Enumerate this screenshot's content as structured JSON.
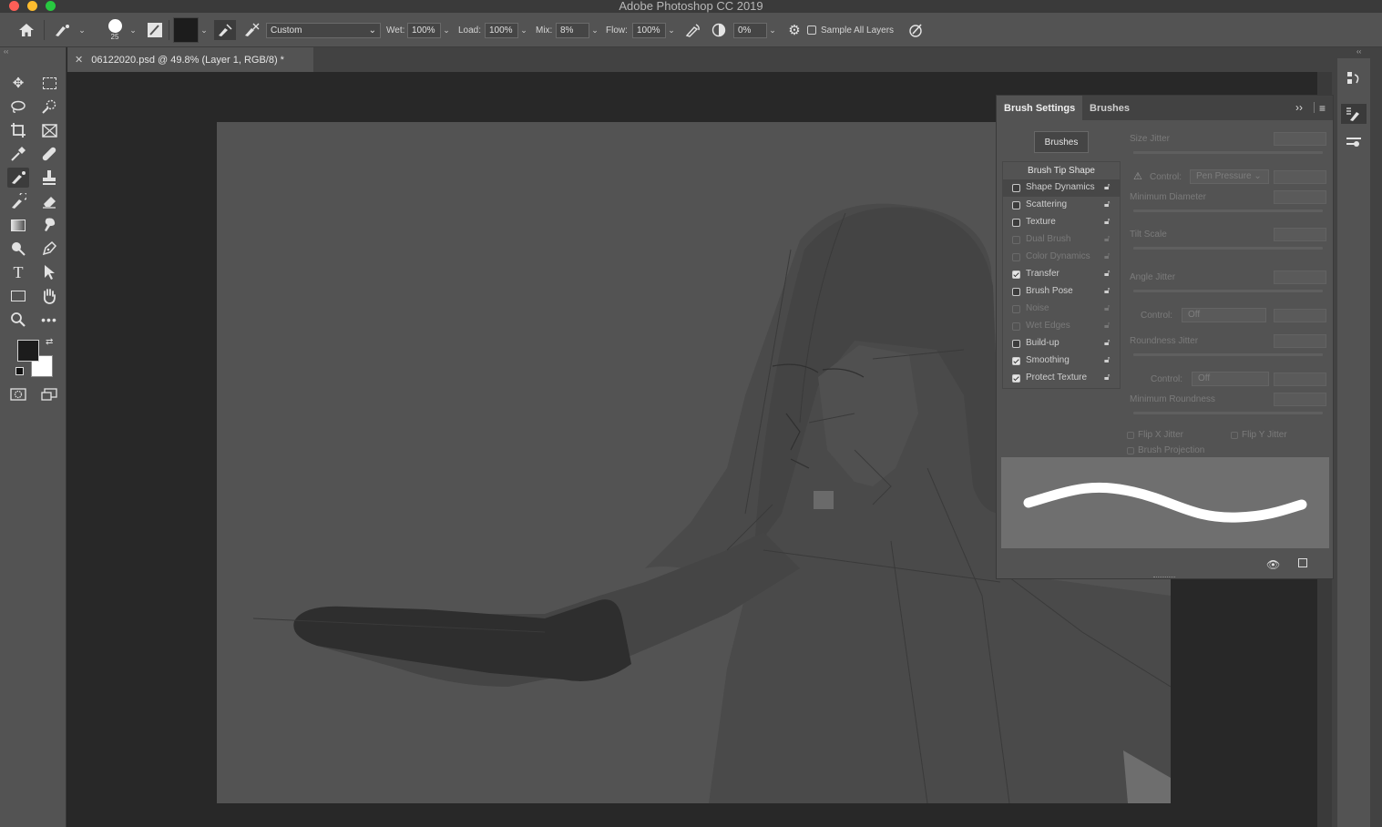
{
  "app": {
    "title": "Adobe Photoshop CC 2019"
  },
  "options_bar": {
    "brush_size": "25",
    "preset": "Custom",
    "wet_label": "Wet:",
    "wet_value": "100%",
    "load_label": "Load:",
    "load_value": "100%",
    "mix_label": "Mix:",
    "mix_value": "8%",
    "flow_label": "Flow:",
    "flow_value": "100%",
    "smoothing_value": "0%",
    "sample_all_layers": "Sample All Layers"
  },
  "document": {
    "tab_title": "06122020.psd @ 49.8% (Layer 1, RGB/8) *"
  },
  "brush_panel": {
    "tab_brush_settings": "Brush Settings",
    "tab_brushes": "Brushes",
    "brushes_button": "Brushes",
    "list_header": "Brush Tip Shape",
    "items": [
      {
        "label": "Shape Dynamics",
        "checked": false,
        "enabled": true
      },
      {
        "label": "Scattering",
        "checked": false,
        "enabled": true
      },
      {
        "label": "Texture",
        "checked": false,
        "enabled": true
      },
      {
        "label": "Dual Brush",
        "checked": false,
        "enabled": false
      },
      {
        "label": "Color Dynamics",
        "checked": false,
        "enabled": false
      },
      {
        "label": "Transfer",
        "checked": true,
        "enabled": true
      },
      {
        "label": "Brush Pose",
        "checked": false,
        "enabled": true
      },
      {
        "label": "Noise",
        "checked": false,
        "enabled": false
      },
      {
        "label": "Wet Edges",
        "checked": false,
        "enabled": false
      },
      {
        "label": "Build-up",
        "checked": false,
        "enabled": true
      },
      {
        "label": "Smoothing",
        "checked": true,
        "enabled": true
      },
      {
        "label": "Protect Texture",
        "checked": true,
        "enabled": true
      }
    ],
    "size_jitter": "Size Jitter",
    "control_label": "Control:",
    "control_pen": "Pen Pressure",
    "minimum_diameter": "Minimum Diameter",
    "tilt_scale": "Tilt Scale",
    "angle_jitter": "Angle Jitter",
    "control_off_1": "Off",
    "roundness_jitter": "Roundness Jitter",
    "control_off_2": "Off",
    "minimum_roundness": "Minimum Roundness",
    "flip_x": "Flip X Jitter",
    "flip_y": "Flip Y Jitter",
    "brush_projection": "Brush Projection"
  },
  "colors": {
    "foreground": "#1c1c1c",
    "background": "#ffffff",
    "canvas": "#535353",
    "ui_panel": "#535353"
  },
  "icons": [
    "home-icon",
    "mixer-brush-icon",
    "brush-preset-icon",
    "toggle-brush-settings-icon",
    "current-load-swatch",
    "load-brush-icon",
    "clean-brush-icon",
    "airbrush-icon",
    "angle-icon",
    "settings-gear-icon",
    "pressure-icon"
  ]
}
